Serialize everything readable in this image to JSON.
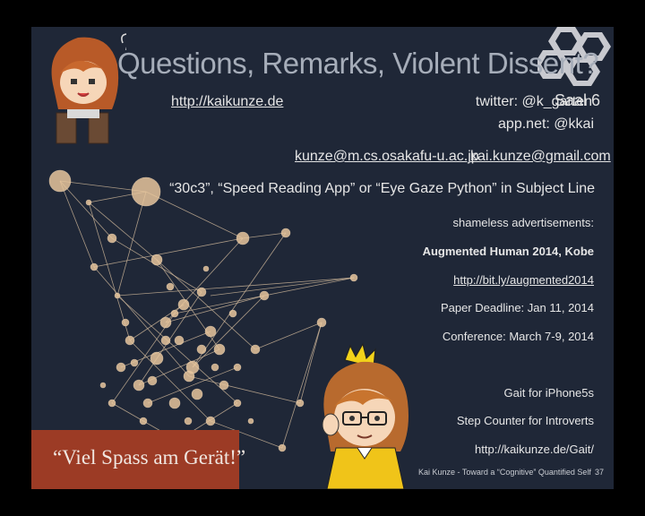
{
  "title": "Questions, Remarks, Violent Dissent?",
  "website": "http://kaikunze.de",
  "twitter": "twitter: @k_garten",
  "appnet": "app.net: @kkai",
  "email1": "kunze@m.cs.osakafu-u.ac.jp",
  "email2": "kai.kunze@gmail.com",
  "subject_line": "“30c3”, “Speed Reading App” or “Eye Gaze Python” in Subject Line",
  "ads_heading": "shameless advertisements:",
  "conference_name": "Augmented Human 2014, Kobe",
  "conference_link": "http://bit.ly/augmented2014",
  "paper_deadline": "Paper Deadline: Jan 11, 2014",
  "conference_dates": "Conference: March 7-9, 2014",
  "gait_title": "Gait for iPhone5s",
  "gait_subtitle": "Step Counter for Introverts",
  "gait_link": "http://kaikunze.de/Gait/",
  "banner_text": "“Viel Spass am Gerät!”",
  "footer_text": "Kai Kunze - Toward a “Cognitive” Quantified Self",
  "page_number": "37",
  "logo_label": "Saal 6",
  "colors": {
    "background": "#1f2737",
    "banner": "#9c3b25",
    "node": "#e8c69c",
    "title": "#a6adb9"
  }
}
